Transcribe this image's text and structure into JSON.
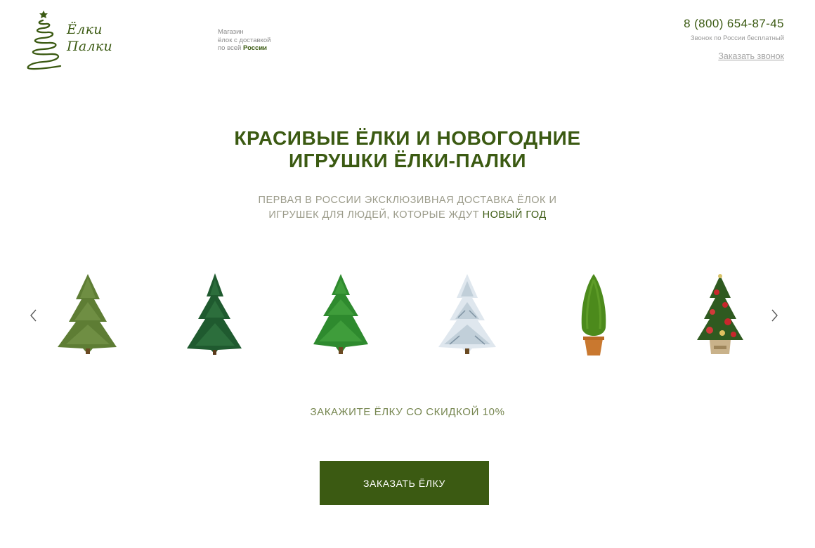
{
  "brand": {
    "name_line1": "Ёлки",
    "name_line2": "Палки",
    "color": "#3b5a12"
  },
  "tagline": {
    "line1": "Магазин",
    "line2": "ёлок с доставкой",
    "line3_prefix": "по всей ",
    "line3_strong": "России"
  },
  "contacts": {
    "phone": "8 (800) 654-87-45",
    "phone_note": "Звонок по России бесплатный",
    "callback_link": "Заказать звонок"
  },
  "hero": {
    "title_line1": "КРАСИВЫЕ ЁЛКИ И НОВОГОДНИЕ",
    "title_line2": "ИГРУШКИ ЁЛКИ-ПАЛКИ",
    "subtitle_line1": "ПЕРВАЯ В РОССИИ ЭКСКЛЮЗИВНАЯ ДОСТАВКА ЁЛОК И",
    "subtitle_line2_prefix": "ИГРУШЕК ДЛЯ ЛЮДЕЙ, КОТОРЫЕ ЖДУТ ",
    "subtitle_line2_accent": "НОВЫЙ ГОД"
  },
  "carousel": {
    "prev_icon": "chevron-left-icon",
    "next_icon": "chevron-right-icon",
    "items": [
      {
        "kind": "green-fir",
        "color": "#5e7d34"
      },
      {
        "kind": "dark-pine",
        "color": "#1f5a2f"
      },
      {
        "kind": "bright-pine",
        "color": "#2e8a2e"
      },
      {
        "kind": "snow-fir",
        "color": "#dfe7ee"
      },
      {
        "kind": "potted-topiary",
        "color": "#4c8a1c"
      },
      {
        "kind": "decorated-tree",
        "color": "#2f5a20"
      }
    ]
  },
  "promo": {
    "discount_text": "ЗАКАЖИТЕ ЁЛКУ СО СКИДКОЙ 10%",
    "cta_label": "ЗАКАЗАТЬ ЁЛКУ"
  }
}
